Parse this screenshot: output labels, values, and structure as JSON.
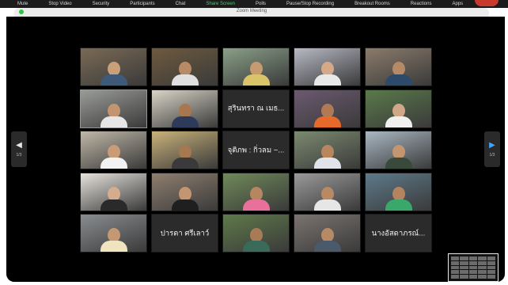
{
  "toolbar": {
    "items": [
      {
        "label": "Mute",
        "highlight": false
      },
      {
        "label": "Stop Video",
        "highlight": false
      },
      {
        "label": "Security",
        "highlight": false
      },
      {
        "label": "Participants",
        "highlight": false
      },
      {
        "label": "Chat",
        "highlight": false
      },
      {
        "label": "Share Screen",
        "highlight": true
      },
      {
        "label": "Polls",
        "highlight": false
      },
      {
        "label": "Pause/Stop Recording",
        "highlight": false
      },
      {
        "label": "Breakout Rooms",
        "highlight": false
      },
      {
        "label": "Reactions",
        "highlight": false
      },
      {
        "label": "Apps",
        "highlight": false
      },
      {
        "label": "More",
        "highlight": false
      }
    ]
  },
  "window": {
    "title": "Zoom Meeting"
  },
  "gallery": {
    "tiles": [
      {
        "type": "video",
        "bg": "#7a6a55",
        "skin": "#c9a07a",
        "shirt": "#3d5a7a"
      },
      {
        "type": "video",
        "bg": "#6e5a3e",
        "skin": "#b98b65",
        "shirt": "#e0e0e0"
      },
      {
        "type": "video",
        "bg": "#8aa088",
        "skin": "#c89a6f",
        "shirt": "#d9c46a"
      },
      {
        "type": "video",
        "bg": "#b7b9c4",
        "skin": "#d3a988",
        "shirt": "#e8e8e8"
      },
      {
        "type": "video",
        "bg": "#8b7b6b",
        "skin": "#b68a66",
        "shirt": "#2d4a6a"
      },
      {
        "type": "video",
        "bg": "#9a9c98",
        "skin": "#c29570",
        "shirt": "#e6e6e6",
        "active": true
      },
      {
        "type": "video",
        "bg": "#d9d4c7",
        "skin": "#a9774f",
        "shirt": "#2e3a5a"
      },
      {
        "type": "name",
        "label": "สุรินทรา ณ เมธ..."
      },
      {
        "type": "video",
        "bg": "#6b5a70",
        "skin": "#b07a55",
        "shirt": "#e86a2a"
      },
      {
        "type": "video",
        "bg": "#5a7a4a",
        "skin": "#d0a888",
        "shirt": "#f0f0f0"
      },
      {
        "type": "video",
        "bg": "#c0b8a8",
        "skin": "#c99b76",
        "shirt": "#f2f2f2"
      },
      {
        "type": "video",
        "bg": "#c9b27a",
        "skin": "#a57850",
        "shirt": "#3a3a3a"
      },
      {
        "type": "name",
        "label": "จุติภพ : กิ่วลม ~..."
      },
      {
        "type": "video",
        "bg": "#7c8a70",
        "skin": "#b8865e",
        "shirt": "#e0e4ea"
      },
      {
        "type": "video",
        "bg": "#a9b7c2",
        "skin": "#c49670",
        "shirt": "#3a4a3a"
      },
      {
        "type": "video",
        "bg": "#e6e2dc",
        "skin": "#d4ad8e",
        "shirt": "#2a2a2a"
      },
      {
        "type": "video",
        "bg": "#8f7f6f",
        "skin": "#c39671",
        "shirt": "#1f1f1f"
      },
      {
        "type": "video",
        "bg": "#6f8a5a",
        "skin": "#b58660",
        "shirt": "#e8709a"
      },
      {
        "type": "video",
        "bg": "#9a9a9a",
        "skin": "#b88a64",
        "shirt": "#e6e6e6"
      },
      {
        "type": "video",
        "bg": "#5e7a8a",
        "skin": "#b4845e",
        "shirt": "#3aa86a"
      },
      {
        "type": "video",
        "bg": "#8a8d90",
        "skin": "#c49872",
        "shirt": "#f0e4c0"
      },
      {
        "type": "name",
        "label": "ปารดา ศรีเลาว์"
      },
      {
        "type": "video",
        "bg": "#5f7a4a",
        "skin": "#a87a55",
        "shirt": "#3a6a5a"
      },
      {
        "type": "video",
        "bg": "#7a7470",
        "skin": "#b78a66",
        "shirt": "#4a5a6a"
      },
      {
        "type": "name",
        "label": "นางอัสดาภรณ์..."
      }
    ]
  },
  "pager": {
    "left_page": "1/3",
    "right_page": "1/3"
  }
}
